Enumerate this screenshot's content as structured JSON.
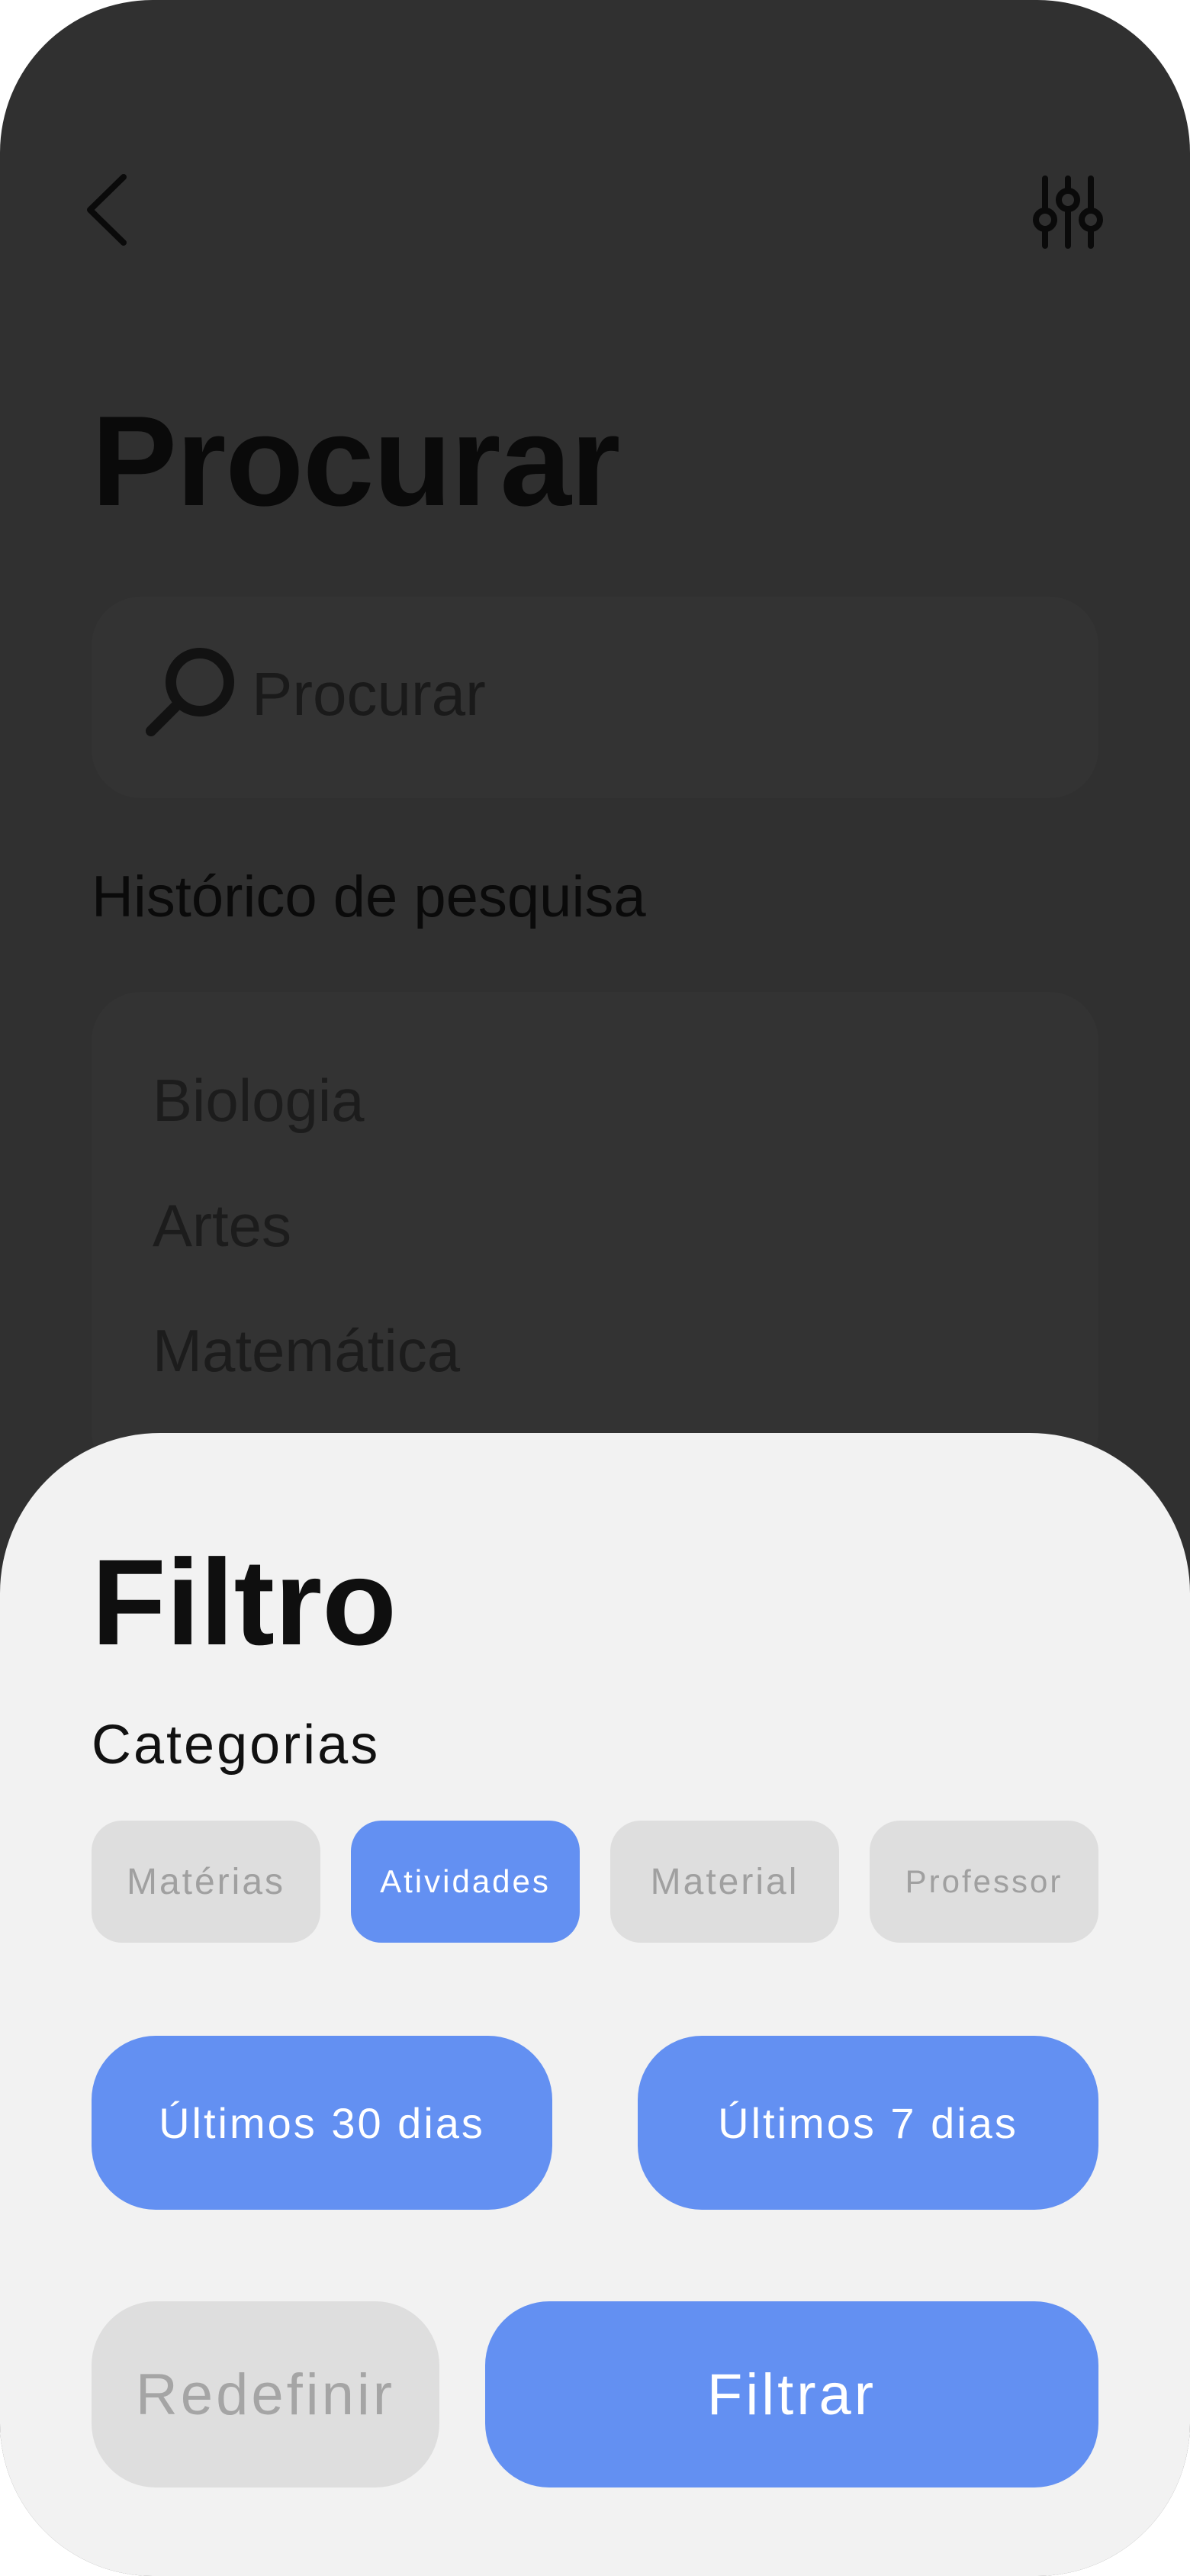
{
  "colors": {
    "overlay_background": "#303030",
    "sheet_background": "#f2f2f2",
    "accent": "#6390f2",
    "chip_inactive": "#dedede",
    "chip_inactive_text": "#a0a0a0"
  },
  "header": {
    "back_icon": "chevron-left-icon",
    "filter_icon": "sliders-icon"
  },
  "page": {
    "title": "Procurar"
  },
  "search": {
    "icon": "search-icon",
    "placeholder": "Procurar"
  },
  "history": {
    "title": "Histórico de pesquisa",
    "items": [
      "Biologia",
      "Artes",
      "Matemática"
    ]
  },
  "filter_sheet": {
    "title": "Filtro",
    "categories_title": "Categorias",
    "categories": [
      {
        "label": "Matérias",
        "selected": false
      },
      {
        "label": "Atividades",
        "selected": true
      },
      {
        "label": "Material",
        "selected": false
      },
      {
        "label": "Professor",
        "selected": false
      }
    ],
    "date_ranges": [
      "Últimos 30 dias",
      "Últimos 7 dias"
    ],
    "reset_label": "Redefinir",
    "apply_label": "Filtrar"
  }
}
